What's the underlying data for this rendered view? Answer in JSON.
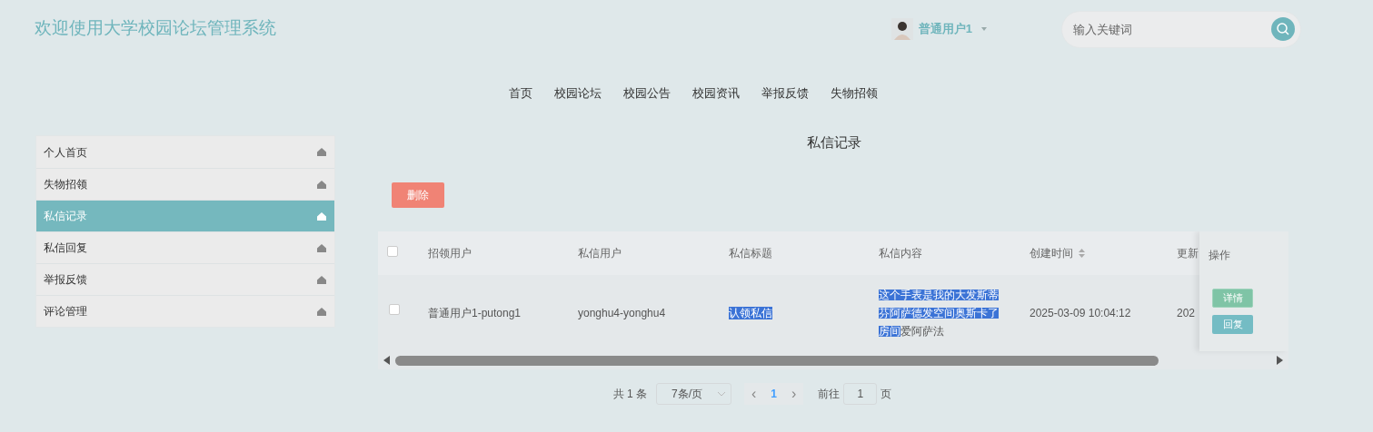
{
  "header": {
    "title": "欢迎使用大学校园论坛管理系统",
    "user": "普通用户1",
    "search": {
      "placeholder": "输入关键词"
    }
  },
  "nav": [
    {
      "label": "首页"
    },
    {
      "label": "校园论坛"
    },
    {
      "label": "校园公告"
    },
    {
      "label": "校园资讯"
    },
    {
      "label": "举报反馈"
    },
    {
      "label": "失物招领"
    }
  ],
  "sidebar": {
    "items": [
      {
        "label": "个人首页",
        "selected": false
      },
      {
        "label": "失物招领",
        "selected": false
      },
      {
        "label": "私信记录",
        "selected": true
      },
      {
        "label": "私信回复",
        "selected": false
      },
      {
        "label": "举报反馈",
        "selected": false
      },
      {
        "label": "评论管理",
        "selected": false
      }
    ]
  },
  "panel": {
    "title": "私信记录",
    "delete_button": "删除"
  },
  "table": {
    "columns": [
      {
        "label": "招领用户",
        "sortable": false
      },
      {
        "label": "私信用户",
        "sortable": false
      },
      {
        "label": "私信标题",
        "sortable": false
      },
      {
        "label": "私信内容",
        "sortable": false
      },
      {
        "label": "创建时间",
        "sortable": true
      },
      {
        "label": "更新"
      }
    ],
    "action_column": "操作",
    "select_all_checked": false,
    "rows": [
      {
        "checked": false,
        "cells": [
          [
            {
              "text": "普通用户1-putong1",
              "selected": false
            }
          ],
          [
            {
              "text": "yonghu4-yonghu4",
              "selected": false
            }
          ],
          [
            {
              "text": "认领私信",
              "selected": true
            }
          ],
          [
            {
              "text": "这个手表是我的大发斯蒂芬阿萨德发空间奥斯卡了房间",
              "selected": true
            },
            {
              "text": "爱阿萨法",
              "selected": false
            }
          ],
          [
            {
              "text": "2025-03-09 10:04:12",
              "selected": false
            }
          ],
          [
            {
              "text": "202",
              "selected": false
            }
          ]
        ],
        "actions": [
          {
            "label": "详情",
            "kind": "detail"
          },
          {
            "label": "回复",
            "kind": "reply"
          }
        ]
      }
    ]
  },
  "pagination": {
    "total": "共 1 条",
    "page_size": "7条/页",
    "prev": "‹",
    "current_page": "1",
    "next": "›",
    "goto_label": "前往",
    "goto_value": "1",
    "page_suffix": "页"
  }
}
